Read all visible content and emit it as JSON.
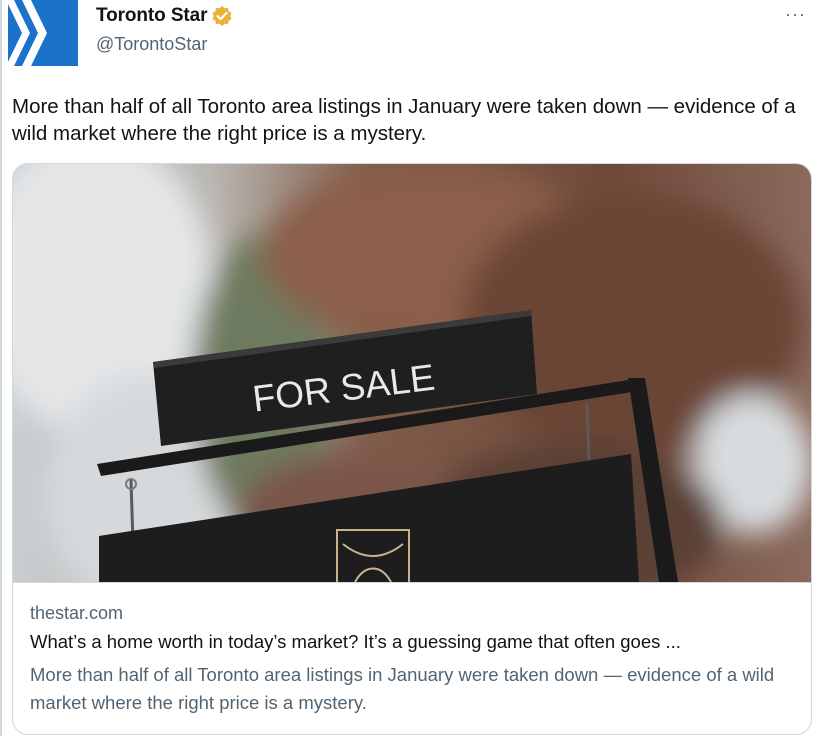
{
  "tweet": {
    "author": {
      "display_name": "Toronto Star",
      "handle": "@TorontoStar",
      "avatar_icon": "toronto-star-chevron-logo",
      "verified_icon": "gold-verified-badge-icon",
      "avatar_color": "#1a73c9",
      "verified_color": "#e8b33a"
    },
    "more_label": "···",
    "text": "More than half of all Toronto area listings in January were taken down — evidence of a wild market where the right price is a mystery.",
    "card": {
      "image_sign_text": "FOR SALE",
      "domain": "thestar.com",
      "title": "What’s a home worth in today’s market? It’s a guessing game that often goes ...",
      "description": "More than half of all Toronto area listings in January were taken down — evidence of a wild market where the right price is a mystery."
    }
  }
}
